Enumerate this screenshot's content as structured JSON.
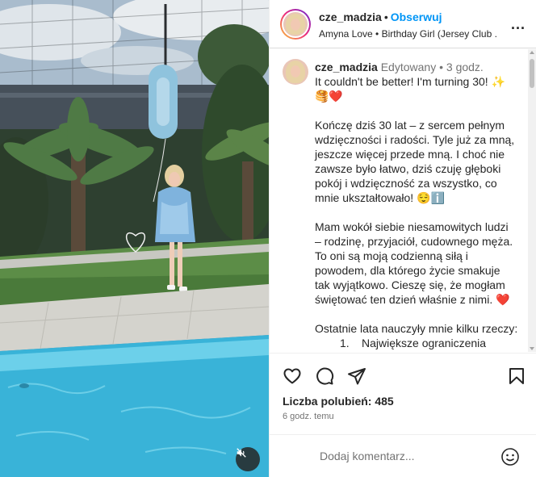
{
  "post": {
    "username": "cze_madzia",
    "follow_label": "Obserwuj",
    "separator": "•",
    "audio_line": "Amyna Love • Birthday Girl (Jersey Club ...",
    "more_label": "..."
  },
  "caption": {
    "username": "cze_madzia",
    "edited_label": "Edytowany",
    "separator": "•",
    "time_label": "3 godz.",
    "lines": {
      "l1": "It couldn't be better! I'm turning 30! ✨",
      "l2": "🥞❤️",
      "p1a": "Kończę dziś 30 lat – z sercem pełnym",
      "p1b": "wdzięczności i radości. Tyle już za mną,",
      "p1c": "jeszcze więcej przede mną. I choć nie",
      "p1d": "zawsze było łatwo, dziś czuję głęboki",
      "p1e": "pokój i wdzięczność za wszystko, co",
      "p1f": "mnie ukształtowało! 😌ℹ️",
      "p2a": "Mam wokół siebie niesamowitych ludzi",
      "p2b": "– rodzinę, przyjaciół, cudownego męża.",
      "p2c": "To oni są moją codzienną siłą i",
      "p2d": "powodem, dla którego życie smakuje",
      "p2e": "tak wyjątkowo. Cieszę się, że mogłam",
      "p2f": "świętować ten dzień właśnie z nimi. ❤️",
      "p3a": "Ostatnie lata nauczyły mnie kilku rzeczy:",
      "item1_num": "1.",
      "item1_text": "Największe ograniczenia"
    }
  },
  "actions": {
    "likes_text": "Liczba polubień: 485",
    "time_ago": "6 godz. temu"
  },
  "comment": {
    "placeholder": "Dodaj komentarz..."
  },
  "icons": {
    "like": "heart-icon",
    "comment": "comment-icon",
    "share": "share-icon",
    "save": "bookmark-icon",
    "emoji": "emoji-icon",
    "mute": "muted-speaker-icon"
  }
}
